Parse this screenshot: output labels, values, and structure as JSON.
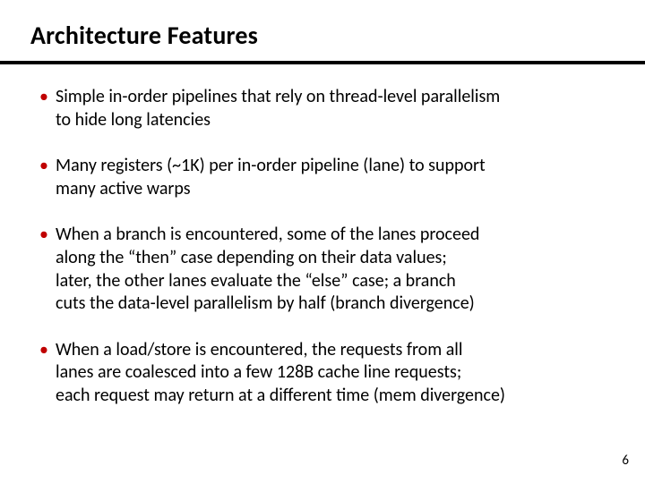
{
  "title": "Architecture Features",
  "bullets": [
    {
      "lines": [
        "Simple in-order pipelines that rely on thread-level parallelism",
        "to hide long latencies"
      ]
    },
    {
      "lines": [
        "Many registers (~1K) per in-order pipeline (lane) to support",
        "many active warps"
      ]
    },
    {
      "lines": [
        "When a branch is encountered, some of the lanes proceed",
        "along the “then” case depending on their data values;",
        "later, the other lanes evaluate the “else” case; a branch",
        "cuts the data-level parallelism by half (branch divergence)"
      ]
    },
    {
      "lines": [
        "When a load/store is encountered, the requests from all",
        "lanes are coalesced into a few 128B cache line requests;",
        "each request may return at a different time (mem divergence)"
      ]
    }
  ],
  "page_number": "6"
}
